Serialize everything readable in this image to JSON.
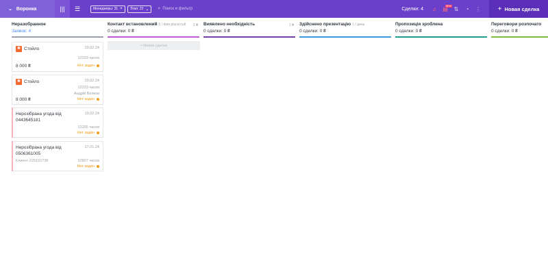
{
  "topbar": {
    "funnel_label": "Воронка",
    "filters": [
      {
        "label": "Менеджеры: 31"
      },
      {
        "label": "Этап: 22"
      }
    ],
    "search_placeholder": "Поиск и фильтр",
    "deals_count": "Сделки: 4",
    "new_badge": "NEW",
    "new_deal_label": "Новая сделка"
  },
  "columns": [
    {
      "title": "Неразобранное",
      "subtitle": "",
      "sum": "",
      "count": "Заявок: 4",
      "color": "#9aa1a9"
    },
    {
      "title": "Контакт встановлений",
      "subtitle": "5 / date.plural.null",
      "sum": "1 ₴",
      "count": "0 сделки: 0 ₴",
      "color": "#c05bd3"
    },
    {
      "title": "Виявлено необхідність",
      "subtitle": "",
      "sum": "1 ₴",
      "count": "0 сделки: 0 ₴",
      "color": "#7a3fa8"
    },
    {
      "title": "Здійснено презентацію",
      "subtitle": "1 / день",
      "sum": "",
      "count": "0 сделки: 0 ₴",
      "color": "#3b9ad9"
    },
    {
      "title": "Пропозиція зроблена",
      "subtitle": "",
      "sum": "",
      "count": "0 сделки: 0 ₴",
      "color": "#1a9e8f"
    },
    {
      "title": "Переговори розпочато",
      "subtitle": "",
      "sum": "",
      "count": "0 сделки: 0 ₴",
      "color": "#7cbf3a"
    }
  ],
  "new_deal_slot": "+ Новая сделка",
  "cards": [
    {
      "title": "Стойло",
      "date": "20.02.24",
      "hours": "12233 часов",
      "owner": "",
      "client": "",
      "task": "Нет задач",
      "price": "8 000 ₴",
      "has_icon": true
    },
    {
      "title": "Стойло",
      "date": "20.02.24",
      "hours": "12233 часов",
      "owner": "Андрій Волков",
      "client": "",
      "task": "Нет задач",
      "price": "8 000 ₴",
      "has_icon": true
    },
    {
      "title": "Нерозібрана угода від 0443645181",
      "date": "19.02.24",
      "hours": "12255 часов",
      "owner": "",
      "client": "",
      "task": "Нет задач",
      "price": "",
      "has_icon": false
    },
    {
      "title": "Нерозібрана угода від 0506361005",
      "date": "27.01.24",
      "hours": "12807 часов",
      "owner": "",
      "client": "Клиент-225151736",
      "task": "Нет задач",
      "price": "",
      "has_icon": false
    }
  ],
  "colors": {
    "topbar": "#6a3fc9",
    "funnel": "#8062d8",
    "new_deal_button": "#5a2eb8",
    "task_warning": "#f39c12",
    "card_left_border": "#f7b3b8",
    "source_icon": "#f26a2e"
  }
}
